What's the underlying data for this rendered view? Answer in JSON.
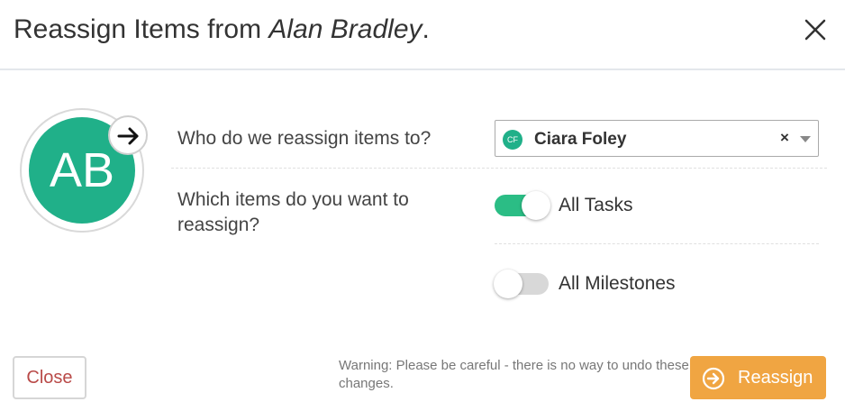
{
  "dialog": {
    "title_prefix": "Reassign Items from ",
    "title_name": "Alan Bradley",
    "title_suffix": "."
  },
  "avatar": {
    "initials": "AB",
    "color": "#20b089"
  },
  "questions": {
    "assignee": "Who do we reassign items to?",
    "items": "Which items do you want to reassign?"
  },
  "assignee_select": {
    "badge_initials": "CF",
    "value": "Ciara Foley",
    "clear_glyph": "×"
  },
  "toggles": [
    {
      "label": "All Tasks",
      "on": true
    },
    {
      "label": "All Milestones",
      "on": false
    }
  ],
  "footer": {
    "close_label": "Close",
    "warning": "Warning: Please be careful - there is no way to undo these changes.",
    "reassign_label": "Reassign"
  },
  "colors": {
    "accent_green": "#2bbd85",
    "reassign_orange": "#f0a542",
    "close_text": "#b94a48"
  },
  "icons": [
    "close-icon",
    "arrow-right-icon",
    "chevron-down-icon",
    "arrow-circle-right-icon"
  ]
}
